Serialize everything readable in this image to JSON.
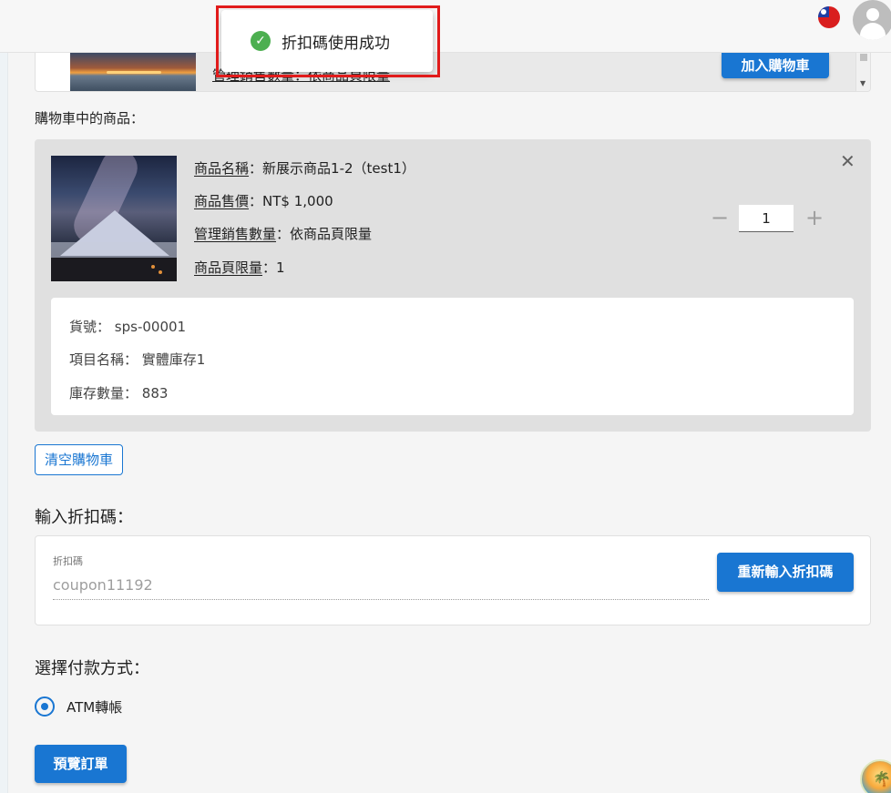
{
  "previous_item": {
    "row_text": "管理銷售數量：依商品頁限量",
    "add_button": "加入購物車"
  },
  "toast": {
    "message": "折扣碼使用成功"
  },
  "cart": {
    "section_label": "購物車中的商品：",
    "item": {
      "name_key": "商品名稱",
      "name_value": "新展示商品1-2（test1）",
      "price_key": "商品售價",
      "price_value": "NT$ 1,000",
      "manage_key": "管理銷售數量",
      "manage_value": "依商品頁限量",
      "limit_key": "商品頁限量",
      "limit_value": "1",
      "separator": "：",
      "quantity": "1"
    },
    "stock": {
      "sku_label": "貨號：",
      "sku_value": "sps-00001",
      "item_name_label": "項目名稱：",
      "item_name_value": "實體庫存1",
      "qty_label": "庫存數量：",
      "qty_value": "883"
    },
    "clear_button": "清空購物車"
  },
  "coupon": {
    "section_title": "輸入折扣碼：",
    "field_label": "折扣碼",
    "value": "coupon11192",
    "reenter_button": "重新輸入折扣碼"
  },
  "payment": {
    "section_title": "選擇付款方式：",
    "options": [
      {
        "label": "ATM轉帳",
        "selected": true
      }
    ],
    "preview_button": "預覽訂單"
  },
  "colors": {
    "primary": "#1976d2",
    "success": "#4caf50",
    "highlight": "#e11b1b"
  },
  "icons": [
    "taiwan-flag-icon",
    "user-avatar-icon",
    "success-check-icon",
    "close-icon",
    "minus-icon",
    "plus-icon"
  ]
}
